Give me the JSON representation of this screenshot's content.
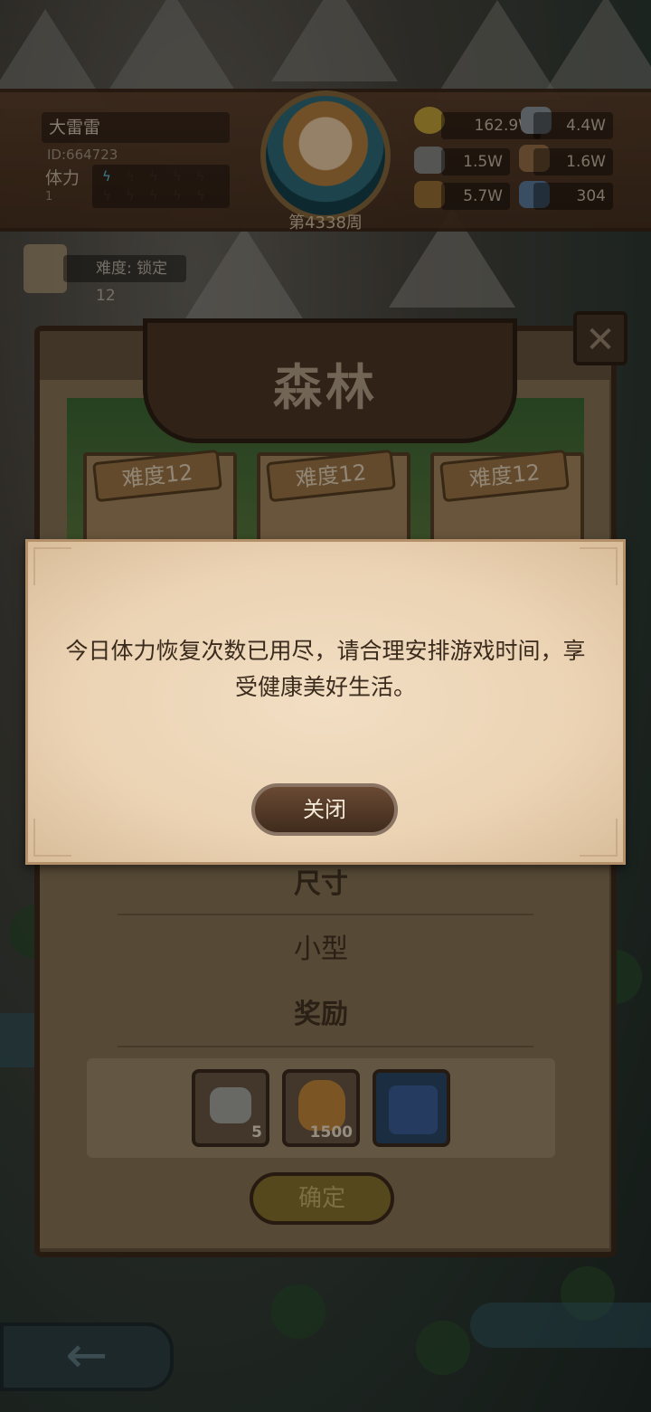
{
  "hud": {
    "player_name": "大雷雷",
    "player_id": "ID:664723",
    "stamina_label": "体力",
    "stamina_value": "1",
    "stamina_filled": 1,
    "stamina_total": 10,
    "week": "第4338周",
    "resources": [
      {
        "icon": "gold-coin-icon",
        "value": "162.9W"
      },
      {
        "icon": "iron-ingot-icon",
        "value": "4.4W"
      },
      {
        "icon": "stone-ore-icon",
        "value": "1.5W"
      },
      {
        "icon": "leather-icon",
        "value": "1.6W"
      },
      {
        "icon": "wood-log-icon",
        "value": "5.7W"
      },
      {
        "icon": "crystal-icon",
        "value": "304"
      }
    ]
  },
  "difficulty_badge": "难度: 锁定12",
  "panel": {
    "title": "森林",
    "cards": [
      "难度12",
      "难度12",
      "难度12"
    ],
    "size_label": "尺寸",
    "size_value": "小型",
    "reward_label": "奖励",
    "rewards": [
      {
        "icon": "stone-ore-icon",
        "count": "5"
      },
      {
        "icon": "gold-bag-icon",
        "count": "1500"
      },
      {
        "icon": "winged-boots-icon",
        "count": ""
      }
    ],
    "confirm_label": "确定"
  },
  "dialog": {
    "message": "今日体力恢复次数已用尽，请合理安排游戏时间，享受健康美好生活。",
    "close_label": "关闭"
  },
  "colors": {
    "dialog_bg": "#ebd3b4",
    "close_button": "#4e3626",
    "stamina_active": "#5fc3e6"
  }
}
